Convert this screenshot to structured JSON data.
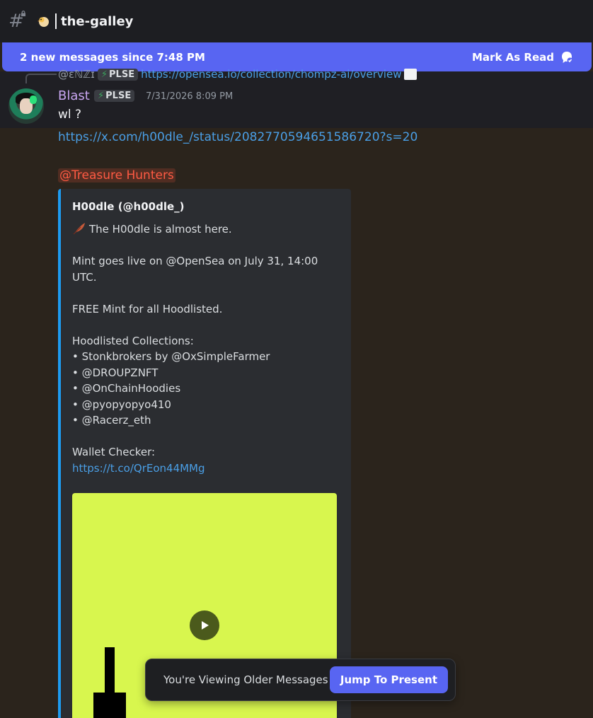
{
  "header": {
    "channel_icon": "hashtag-lock-icon",
    "emoji_icon": "chick-emoji-icon",
    "channel_name": "the-galley"
  },
  "new_messages_bar": {
    "text": "2 new messages since 7:48 PM",
    "action_label": "Mark As Read",
    "action_icon": "mark-read-icon"
  },
  "reply_preview": {
    "username": "@ɛℕℤɪ",
    "badge": "PLSE",
    "link_text": "https://opensea.io/collection/chompz-ai/overview",
    "attachment_icon": "image-icon"
  },
  "message": {
    "username": "Blast",
    "badge": "PLSE",
    "timestamp": "7/31/2026 8:09 PM",
    "text": "wl ?",
    "link": "https://x.com/h00dle_/status/2082770594651586720?s=20",
    "mention": "@Treasure Hunters"
  },
  "embed": {
    "author": "H00dle (@h00dle_)",
    "intro": "The H00dle is almost here.",
    "body": "Mint goes live on @OpenSea on July 31, 14:00 UTC.\n\nFREE Mint for all Hoodlisted.\n\nHoodlisted Collections:\n• Stonkbrokers by @OxSimpleFarmer\n• @DROUPZNFT\n• @OnChainHoodies\n• @pyopyopyo410\n• @Racerz_eth\n\nWallet Checker:",
    "checker_link": "https://t.co/QrEon44MMg",
    "media_color": "#d8f64e",
    "play_icon": "play-icon"
  },
  "older_messages_bar": {
    "text": "You're Viewing Older Messages",
    "button": "Jump To Present"
  },
  "colors": {
    "accent": "#5865f2",
    "link": "#4a9fe6",
    "mention": "#ff5a43",
    "username": "#c9a6f2",
    "embed_border": "#1d9bf0"
  }
}
